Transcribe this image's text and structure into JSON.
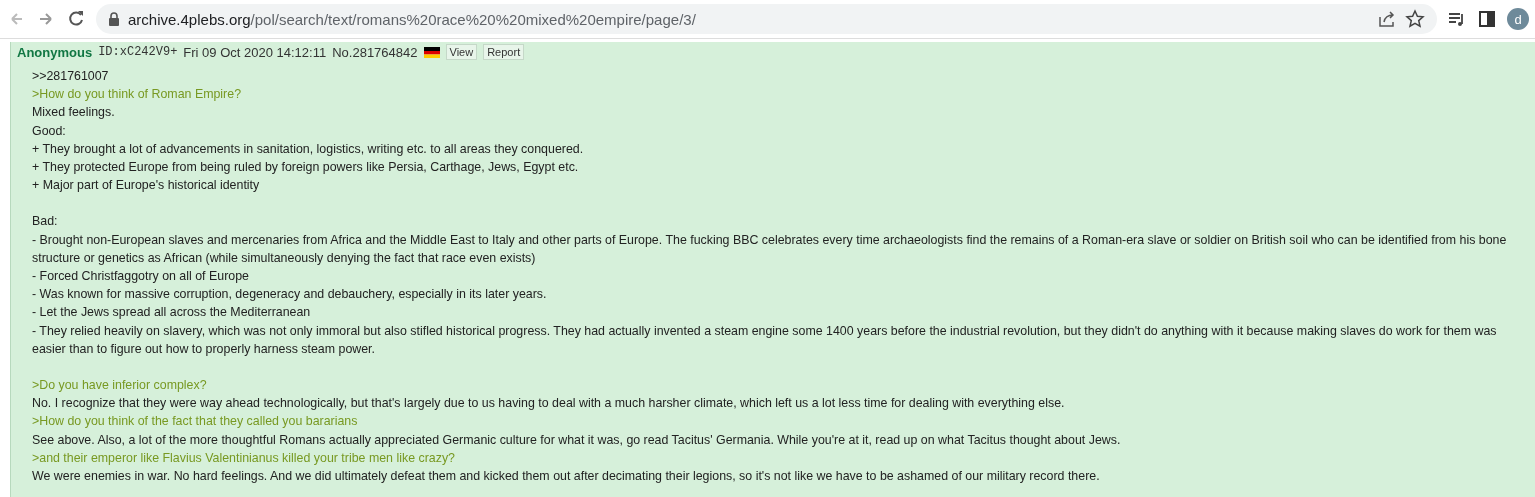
{
  "browser": {
    "url_host": "archive.4plebs.org",
    "url_path": "/pol/search/text/romans%20race%20%20mixed%20empire/page/3/",
    "profile_initial": "d"
  },
  "post": {
    "name": "Anonymous",
    "poster_id": "ID:xC242V9+",
    "date": "Fri 09 Oct 2020 14:12:11",
    "number": "No.281764842",
    "buttons": [
      "View",
      "Report"
    ],
    "paragraphs": [
      [
        {
          "kind": "text",
          "text": ">>281761007"
        },
        {
          "kind": "quote",
          "text": ">How do you think of Roman Empire?"
        },
        {
          "kind": "text",
          "text": "Mixed feelings."
        },
        {
          "kind": "text",
          "text": "Good:"
        },
        {
          "kind": "text",
          "text": "+ They brought a lot of advancements in sanitation, logistics, writing etc. to all areas they conquered."
        },
        {
          "kind": "text",
          "text": "+ They protected Europe from being ruled by foreign powers like Persia, Carthage, Jews, Egypt etc."
        },
        {
          "kind": "text",
          "text": "+ Major part of Europe's historical identity"
        }
      ],
      [
        {
          "kind": "text",
          "text": "Bad:"
        },
        {
          "kind": "text",
          "text": "- Brought non-European slaves and mercenaries from Africa and the Middle East to Italy and other parts of Europe. The fucking BBC celebrates every time archaeologists find the remains of a Roman-era slave or soldier on British soil who can be identified from his bone structure or genetics as African (while simultaneously denying the fact that race even exists)"
        },
        {
          "kind": "text",
          "text": "- Forced Christfaggotry on all of Europe"
        },
        {
          "kind": "text",
          "text": "- Was known for massive corruption, degeneracy and debauchery, especially in its later years."
        },
        {
          "kind": "text",
          "text": "- Let the Jews spread all across the Mediterranean"
        },
        {
          "kind": "text",
          "text": "- They relied heavily on slavery, which was not only immoral but also stifled historical progress. They had actually invented a steam engine some 1400 years before the industrial revolution, but they didn't do anything with it because making slaves do work for them was easier than to figure out how to properly harness steam power."
        }
      ],
      [
        {
          "kind": "quote",
          "text": ">Do you have inferior complex?"
        },
        {
          "kind": "text",
          "text": "No. I recognize that they were way ahead technologically, but that's largely due to us having to deal with a much harsher climate, which left us a lot less time for dealing with everything else."
        },
        {
          "kind": "quote",
          "text": ">How do you think of the fact that they called you bararians"
        },
        {
          "kind": "text",
          "text": "See above. Also, a lot of the more thoughtful Romans actually appreciated Germanic culture for what it was, go read Tacitus' Germania. While you're at it, read up on what Tacitus thought about Jews."
        },
        {
          "kind": "quote",
          "text": ">and their emperor like Flavius Valentinianus killed your tribe men like crazy?"
        },
        {
          "kind": "text",
          "text": "We were enemies in war. No hard feelings. And we did ultimately defeat them and kicked them out after decimating their legions, so it's not like we have to be ashamed of our military record there."
        }
      ]
    ]
  }
}
